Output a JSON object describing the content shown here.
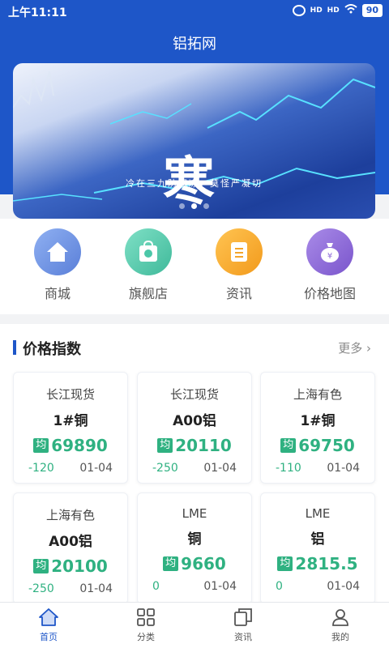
{
  "status_bar": {
    "time": "上午11:11",
    "battery": "90",
    "signal_1": "HD",
    "signal_2": "HD"
  },
  "app": {
    "title": "铝拓网"
  },
  "banner": {
    "big_text": "寒",
    "slogan": "冷在三九防寒冻，莫怪严凝切"
  },
  "quick_links": [
    {
      "label": "商城",
      "icon": "house-icon",
      "color": "#6b8fe0"
    },
    {
      "label": "旗舰店",
      "icon": "shop-bag-icon",
      "color": "#4cc7a8"
    },
    {
      "label": "资讯",
      "icon": "document-icon",
      "color": "#f4a52a"
    },
    {
      "label": "价格地图",
      "icon": "money-bag-icon",
      "color": "#8e6bd8"
    }
  ],
  "price_index": {
    "title": "价格指数",
    "more": "更多",
    "avg_badge": "均",
    "cards": [
      {
        "source": "长江现货",
        "name": "1#铜",
        "price": "69890",
        "change": "-120",
        "date": "01-04"
      },
      {
        "source": "长江现货",
        "name": "A00铝",
        "price": "20110",
        "change": "-250",
        "date": "01-04"
      },
      {
        "source": "上海有色",
        "name": "1#铜",
        "price": "69750",
        "change": "-110",
        "date": "01-04"
      },
      {
        "source": "上海有色",
        "name": "A00铝",
        "price": "20100",
        "change": "-250",
        "date": "01-04"
      },
      {
        "source": "LME",
        "name": "铜",
        "price": "9660",
        "change": "0",
        "date": "01-04"
      },
      {
        "source": "LME",
        "name": "铝",
        "price": "2815.5",
        "change": "0",
        "date": "01-04"
      }
    ]
  },
  "tabs": [
    {
      "label": "首页",
      "icon": "home-icon",
      "active": true
    },
    {
      "label": "分类",
      "icon": "grid-icon",
      "active": false
    },
    {
      "label": "资讯",
      "icon": "news-icon",
      "active": false
    },
    {
      "label": "我的",
      "icon": "person-icon",
      "active": false
    }
  ],
  "colors": {
    "brand": "#1e56c8",
    "up_down": "#2fb181"
  }
}
